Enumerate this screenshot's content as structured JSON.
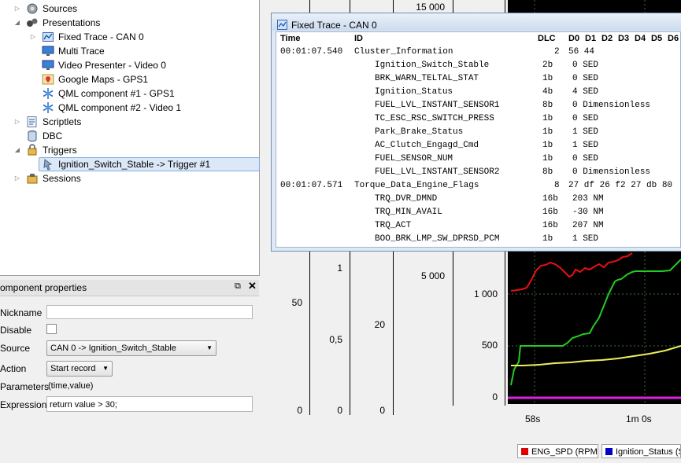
{
  "tree": {
    "items": [
      {
        "label": "Sources",
        "icon": "sources-icon",
        "expand": "collapsed"
      },
      {
        "label": "Presentations",
        "icon": "presentations-icon",
        "expand": "expanded"
      },
      {
        "label": "Fixed Trace - CAN 0",
        "icon": "fixed-trace-icon",
        "expand": "collapsed"
      },
      {
        "label": "Multi Trace",
        "icon": "monitor-icon",
        "expand": "none"
      },
      {
        "label": "Video Presenter - Video 0",
        "icon": "monitor-icon",
        "expand": "none"
      },
      {
        "label": "Google Maps - GPS1",
        "icon": "map-icon",
        "expand": "none"
      },
      {
        "label": "QML component #1 - GPS1",
        "icon": "snowflake-icon",
        "expand": "none"
      },
      {
        "label": "QML component #2 - Video 1",
        "icon": "snowflake-icon",
        "expand": "none"
      },
      {
        "label": "Scriptlets",
        "icon": "scriptlets-icon",
        "expand": "collapsed"
      },
      {
        "label": "DBC",
        "icon": "database-icon",
        "expand": "none"
      },
      {
        "label": "Triggers",
        "icon": "triggers-icon",
        "expand": "expanded"
      },
      {
        "label": "Ignition_Switch_Stable -> Trigger #1",
        "icon": "trigger-item-icon",
        "expand": "none"
      },
      {
        "label": "Sessions",
        "icon": "sessions-icon",
        "expand": "collapsed"
      }
    ]
  },
  "props": {
    "title": "omponent properties",
    "nickname_label": "Nickname",
    "nickname_value": "",
    "disable_label": "Disable",
    "source_label": "Source",
    "source_value": "CAN 0 -> Ignition_Switch_Stable",
    "action_label": "Action",
    "action_value": "Start record",
    "parameters_label": "Parameters",
    "parameters_value": "(time,value)",
    "expression_label": "Expression",
    "expression_value": "return value > 30;"
  },
  "plots": {
    "axis1_ticks": [
      "50",
      "0"
    ],
    "axis2_ticks": [
      "1",
      "0,5",
      "0"
    ],
    "axis3_ticks": [
      "20",
      "0"
    ],
    "axis4_ticks": [
      "15 000",
      "5 000"
    ],
    "axis5_ticks": [
      "1 000",
      "500",
      "0"
    ],
    "time_ticks": [
      "58s",
      "1m 0s"
    ]
  },
  "chart_data": {
    "type": "line",
    "series": [
      {
        "name": "ENG_SPD (RPM)",
        "color": "#e00000"
      },
      {
        "name": "Ignition_Status (S",
        "color": "#0000c8"
      }
    ],
    "visible_curves": [
      "red",
      "green",
      "yellow",
      "magenta"
    ]
  },
  "legend": {
    "eng_spd": "ENG_SPD (RPM)",
    "ign_status": "Ignition_Status (S"
  },
  "trace": {
    "title": "Fixed Trace - CAN 0",
    "headers": {
      "time": "Time",
      "id": "ID",
      "dlc": "DLC",
      "d0": "D0",
      "d1": "D1",
      "d2": "D2",
      "d3": "D3",
      "d4": "D4",
      "d5": "D5",
      "d6": "D6"
    },
    "rows": [
      {
        "time": "00:01:07.540",
        "id": "Cluster_Information",
        "dlc": "2",
        "data": "56 44",
        "indent": false
      },
      {
        "time": "",
        "id": "Ignition_Switch_Stable",
        "dlc": "2b",
        "data": "0 SED",
        "indent": true
      },
      {
        "time": "",
        "id": "BRK_WARN_TELTAL_STAT",
        "dlc": "1b",
        "data": "0 SED",
        "indent": true
      },
      {
        "time": "",
        "id": "Ignition_Status",
        "dlc": "4b",
        "data": "4 SED",
        "indent": true
      },
      {
        "time": "",
        "id": "FUEL_LVL_INSTANT_SENSOR1",
        "dlc": "8b",
        "data": "0 Dimensionless",
        "indent": true
      },
      {
        "time": "",
        "id": "TC_ESC_RSC_SWITCH_PRESS",
        "dlc": "1b",
        "data": "0 SED",
        "indent": true
      },
      {
        "time": "",
        "id": "Park_Brake_Status",
        "dlc": "1b",
        "data": "1 SED",
        "indent": true
      },
      {
        "time": "",
        "id": "AC_Clutch_Engagd_Cmd",
        "dlc": "1b",
        "data": "1 SED",
        "indent": true
      },
      {
        "time": "",
        "id": "FUEL_SENSOR_NUM",
        "dlc": "1b",
        "data": "0 SED",
        "indent": true
      },
      {
        "time": "",
        "id": "FUEL_LVL_INSTANT_SENSOR2",
        "dlc": "8b",
        "data": "0 Dimensionless",
        "indent": true
      },
      {
        "time": "00:01:07.571",
        "id": "Torque_Data_Engine_Flags",
        "dlc": "8",
        "data": "27 df 26 f2 27 db 80",
        "indent": false
      },
      {
        "time": "",
        "id": "TRQ_DVR_DMND",
        "dlc": "16b",
        "data": "203 NM",
        "indent": true
      },
      {
        "time": "",
        "id": "TRQ_MIN_AVAIL",
        "dlc": "16b",
        "data": "-30 NM",
        "indent": true
      },
      {
        "time": "",
        "id": "TRQ_ACT",
        "dlc": "16b",
        "data": "207 NM",
        "indent": true
      },
      {
        "time": "",
        "id": "BOO_BRK_LMP_SW_DPRSD_PCM",
        "dlc": "1b",
        "data": "1 SED",
        "indent": true
      }
    ]
  }
}
